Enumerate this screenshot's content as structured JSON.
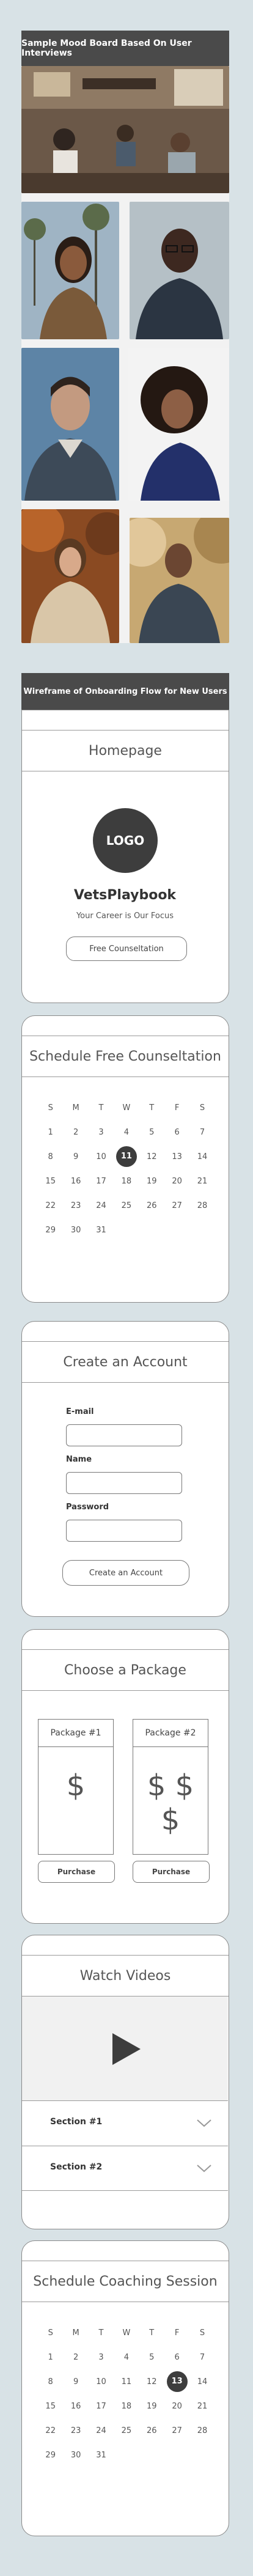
{
  "mood_board": {
    "title": "Sample Mood Board Based On User Interviews",
    "photos": [
      {
        "name": "photo-office",
        "desc": "cafe-office"
      },
      {
        "name": "photo-woman-palm",
        "desc": "woman-outdoors"
      },
      {
        "name": "photo-man-glasses",
        "desc": "man-glasses"
      },
      {
        "name": "photo-man-blue",
        "desc": "man-portrait"
      },
      {
        "name": "photo-woman-curly",
        "desc": "woman-curly"
      },
      {
        "name": "photo-woman-autumn",
        "desc": "woman-autumn"
      },
      {
        "name": "photo-man-park",
        "desc": "man-park"
      }
    ]
  },
  "wireframe": {
    "title": "Wireframe of Onboarding Flow for New Users"
  },
  "homepage": {
    "title": "Homepage",
    "logo": "LOGO",
    "brand": "VetsPlaybook",
    "tagline": "Your Career is Our Focus",
    "button": "Free Counseltation"
  },
  "schedule_free": {
    "title": "Schedule Free Counseltation",
    "weekdays": [
      "S",
      "M",
      "T",
      "W",
      "T",
      "F",
      "S"
    ],
    "weeks": [
      [
        "1",
        "2",
        "3",
        "4",
        "5",
        "6",
        "7"
      ],
      [
        "8",
        "9",
        "10",
        "11",
        "12",
        "13",
        "14"
      ],
      [
        "15",
        "16",
        "17",
        "18",
        "19",
        "20",
        "21"
      ],
      [
        "22",
        "23",
        "24",
        "25",
        "26",
        "27",
        "28"
      ],
      [
        "29",
        "30",
        "31",
        "",
        "",
        "",
        ""
      ]
    ],
    "selected": "11"
  },
  "account": {
    "title": "Create an Account",
    "email_label": "E-mail",
    "name_label": "Name",
    "password_label": "Password",
    "button": "Create an Account"
  },
  "package": {
    "title": "Choose a Package",
    "p1_label": "Package #1",
    "p1_price": "$",
    "p2_label": "Package #2",
    "p2_price": "$ $ $",
    "purchase": "Purchase"
  },
  "videos": {
    "title": "Watch Videos",
    "section1": "Section #1",
    "section2": "Section #2"
  },
  "schedule_coaching": {
    "title": "Schedule Coaching Session",
    "weekdays": [
      "S",
      "M",
      "T",
      "W",
      "T",
      "F",
      "S"
    ],
    "weeks": [
      [
        "1",
        "2",
        "3",
        "4",
        "5",
        "6",
        "7"
      ],
      [
        "8",
        "9",
        "10",
        "11",
        "12",
        "13",
        "14"
      ],
      [
        "15",
        "16",
        "17",
        "18",
        "19",
        "20",
        "21"
      ],
      [
        "22",
        "23",
        "24",
        "25",
        "26",
        "27",
        "28"
      ],
      [
        "29",
        "30",
        "31",
        "",
        "",
        "",
        ""
      ]
    ],
    "selected": "13"
  },
  "colors": {
    "background": "#d8e2e6",
    "header_dark": "#4a4a4a",
    "highlight": "#3d3d3d"
  }
}
